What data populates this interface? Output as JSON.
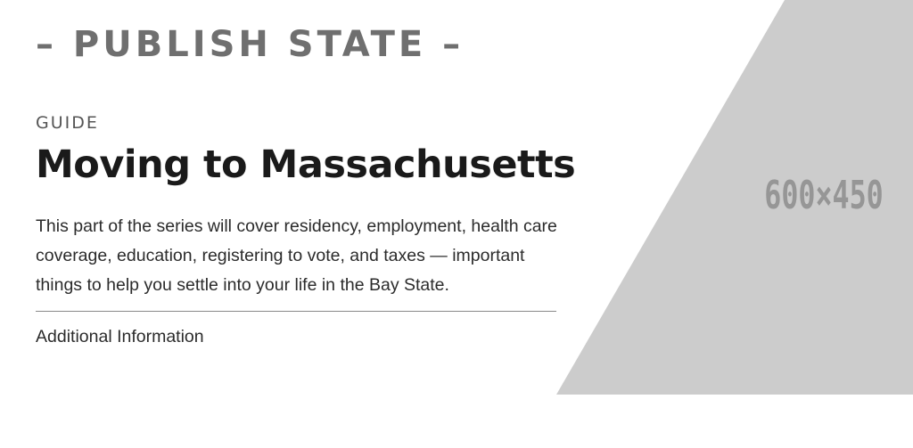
{
  "header": {
    "publish_state": "– PUBLISH STATE –"
  },
  "article": {
    "eyebrow": "GUIDE",
    "title": "Moving to Massachusetts",
    "description": "This part of the series will cover residency, employment, health care coverage, education, registering to vote, and taxes — important things to help you settle into your life in the Bay State.",
    "additional_link": "Additional Information"
  },
  "image_placeholder": {
    "label": "600×450",
    "fill_color": "#cccccc",
    "text_color": "#969696"
  }
}
